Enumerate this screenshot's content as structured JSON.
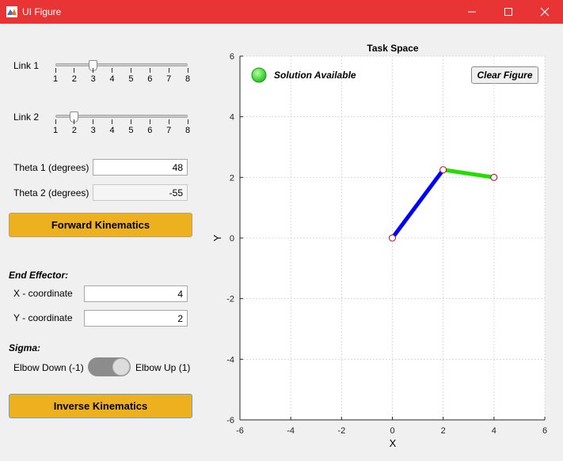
{
  "window": {
    "title": "UI Figure"
  },
  "controls": {
    "link1_label": "Link 1",
    "link2_label": "Link 2",
    "link1_value": 3,
    "link2_value": 2,
    "slider_ticks": [
      "1",
      "2",
      "3",
      "4",
      "5",
      "6",
      "7",
      "8"
    ],
    "theta1_label": "Theta 1 (degrees)",
    "theta1_value": "48",
    "theta2_label": "Theta 2 (degrees)",
    "theta2_value": "-55",
    "forward_button": "Forward Kinematics",
    "end_effector_heading": "End Effector:",
    "x_label": "X - coordinate",
    "x_value": "4",
    "y_label": "Y - coordinate",
    "y_value": "2",
    "sigma_heading": "Sigma:",
    "elbow_down_label": "Elbow Down (-1)",
    "elbow_up_label": "Elbow Up (1)",
    "sigma_state": "Elbow Up (1)",
    "inverse_button": "Inverse Kinematics"
  },
  "plot": {
    "title": "Task Space",
    "status_text": "Solution Available",
    "clear_button": "Clear Figure",
    "lamp_color": "#22dd22"
  },
  "chart_data": {
    "type": "line",
    "title": "Task Space",
    "xlabel": "X",
    "ylabel": "Y",
    "xlim": [
      -6,
      6
    ],
    "ylim": [
      -6,
      6
    ],
    "xticks": [
      -6,
      -4,
      -2,
      0,
      2,
      4,
      6
    ],
    "yticks": [
      -6,
      -4,
      -2,
      0,
      2,
      4,
      6
    ],
    "grid": true,
    "series": [
      {
        "color": "#0000ff",
        "x": [
          0,
          2
        ],
        "y": [
          0,
          2.25
        ]
      },
      {
        "color": "#22dd00",
        "x": [
          2,
          4
        ],
        "y": [
          2.25,
          2
        ]
      }
    ],
    "joints": {
      "x": [
        0,
        2,
        4
      ],
      "y": [
        0,
        2.25,
        2
      ],
      "color": "#cc0000"
    }
  }
}
